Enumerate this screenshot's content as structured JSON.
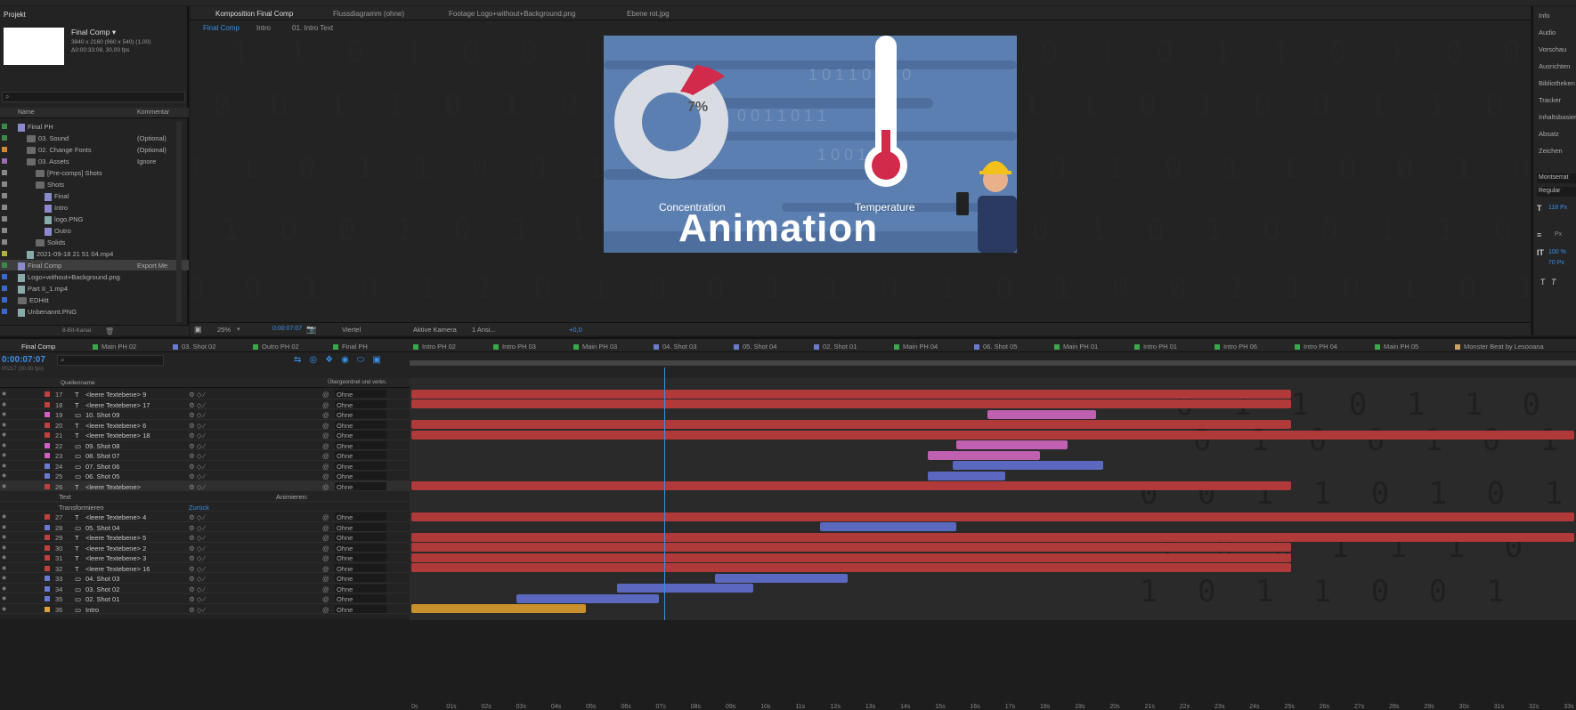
{
  "project_panel": {
    "title": "Projekt",
    "comp_name": "Final Comp ▾",
    "comp_info1": "3840 x 2160 (960 x 540) (1,00)",
    "comp_info2": "Δ0:00:33:08, 30,00 fps",
    "col_name": "Name",
    "col_comment": "Kommentar",
    "footer_depth": "8-Bit-Kanal",
    "items": [
      {
        "name": "Final PH",
        "comment": "",
        "type": "comp",
        "color": "#3a8a4a"
      },
      {
        "name": "03. Sound",
        "comment": "(Optional)",
        "type": "folder",
        "color": "#3a8a4a"
      },
      {
        "name": "02. Change Fonts",
        "comment": "(Optional)",
        "type": "folder",
        "color": "#d08a30"
      },
      {
        "name": "03. Assets",
        "comment": "Ignore",
        "type": "folder",
        "color": "#9a6bb0"
      },
      {
        "name": "[Pre-comps] Shots",
        "comment": "",
        "type": "folder",
        "color": "#888"
      },
      {
        "name": "Shots",
        "comment": "",
        "type": "folder",
        "color": "#888"
      },
      {
        "name": "Final",
        "comment": "",
        "type": "comp",
        "color": "#888"
      },
      {
        "name": "Intro",
        "comment": "",
        "type": "comp",
        "color": "#888"
      },
      {
        "name": "logo.PNG",
        "comment": "",
        "type": "file",
        "color": "#888"
      },
      {
        "name": "Outro",
        "comment": "",
        "type": "comp",
        "color": "#888"
      },
      {
        "name": "Solids",
        "comment": "",
        "type": "folder",
        "color": "#888"
      },
      {
        "name": "2021-09-18 21 51 04.mp4",
        "comment": "",
        "type": "file",
        "color": "#b0b040"
      },
      {
        "name": "Final Comp",
        "comment": "Export Me",
        "type": "comp",
        "color": "#3a8a4a"
      },
      {
        "name": "Logo+without+Background.png",
        "comment": "",
        "type": "file",
        "color": "#3a6ad0"
      },
      {
        "name": "Part II_1.mp4",
        "comment": "",
        "type": "file",
        "color": "#3a6ad0"
      },
      {
        "name": "EDHitt",
        "comment": "",
        "type": "folder",
        "color": "#3a6ad0"
      },
      {
        "name": "Unbenannt.PNG",
        "comment": "",
        "type": "file",
        "color": "#3a6ad0"
      }
    ]
  },
  "comp_panel": {
    "tabs": [
      {
        "label": "Komposition Final Comp"
      },
      {
        "label": "Flussdiagramm (ohne)"
      },
      {
        "label": "Footage Logo+without+Background.png"
      },
      {
        "label": "Ebene rot.jpg"
      }
    ],
    "breadcrumbs": [
      "Final Comp",
      "Intro",
      "01. Intro Text"
    ],
    "zoom": "25%",
    "timecode": "0:00:07:07",
    "resolution": "Viertel",
    "camera": "Aktive Kamera",
    "views": "1 Ansi...",
    "exposure": "+0,0"
  },
  "preview": {
    "donut_value": 7,
    "donut_label": "7%",
    "label_left": "Concentration",
    "label_right": "Temperature",
    "title": "Animation",
    "thermometer_level": 0.28,
    "colors": {
      "bg": "#5b7fb0",
      "accent": "#d12a4a",
      "donut": "#d9dde3"
    }
  },
  "right_panel": {
    "items": [
      "Info",
      "Audio",
      "Vorschau",
      "Ausrichten",
      "Bibliotheken",
      "Tracker",
      "Inhaltsbasiert",
      "Absatz",
      "Zeichen"
    ],
    "font": "Montserrat",
    "style": "Regular",
    "size": "118 Px",
    "tracking": "100 %",
    "leading": "70 Px",
    "units_px": "Px"
  },
  "timeline": {
    "active_tab": "Final Comp",
    "comp_tabs": [
      {
        "label": "Main PH 02",
        "color": "#3aa84a"
      },
      {
        "label": "03. Shot 02",
        "color": "#6a7ad0"
      },
      {
        "label": "Outro PH 02",
        "color": "#3aa84a"
      },
      {
        "label": "Final PH",
        "color": "#3aa84a"
      },
      {
        "label": "Intro PH 02",
        "color": "#3aa84a"
      },
      {
        "label": "Intro PH 03",
        "color": "#3aa84a"
      },
      {
        "label": "Main PH 03",
        "color": "#3aa84a"
      },
      {
        "label": "04. Shot 03",
        "color": "#6a7ad0"
      },
      {
        "label": "05. Shot 04",
        "color": "#6a7ad0"
      },
      {
        "label": "02. Shot 01",
        "color": "#6a7ad0"
      },
      {
        "label": "Main PH 04",
        "color": "#3aa84a"
      },
      {
        "label": "06. Shot 05",
        "color": "#6a7ad0"
      },
      {
        "label": "Main PH 01",
        "color": "#3aa84a"
      },
      {
        "label": "Intro PH 01",
        "color": "#3aa84a"
      },
      {
        "label": "Intro PH 06",
        "color": "#3aa84a"
      },
      {
        "label": "Intro PH 04",
        "color": "#3aa84a"
      },
      {
        "label": "Main PH 05",
        "color": "#3aa84a"
      },
      {
        "label": "Monster Beat by Lesooana",
        "color": "#c8a060"
      }
    ],
    "timecode": "0:00:07:07",
    "frame_sub": "00217 (30.00 fps)",
    "col_source": "Quellenname",
    "col_parent": "Übergeordnet und verkn.",
    "ruler": [
      "0s",
      "01s",
      "02s",
      "03s",
      "04s",
      "05s",
      "06s",
      "07s",
      "08s",
      "09s",
      "10s",
      "11s",
      "12s",
      "13s",
      "14s",
      "15s",
      "16s",
      "17s",
      "18s",
      "19s",
      "20s",
      "21s",
      "22s",
      "23s",
      "24s",
      "25s",
      "26s",
      "27s",
      "28s",
      "29s",
      "30s",
      "31s",
      "32s",
      "33s"
    ],
    "current_time_s": 7.23,
    "total_s": 33.3,
    "parent_value": "Ohne",
    "layers": [
      {
        "num": "17",
        "name": "<leere Textebene> 9",
        "type": "T",
        "color": "#c04040",
        "bar": [
          0,
          25.2
        ],
        "bcolor": "#b03a3a"
      },
      {
        "num": "18",
        "name": "<leere Textebene> 17",
        "type": "T",
        "color": "#c04040",
        "bar": [
          0,
          25.2
        ],
        "bcolor": "#b03a3a"
      },
      {
        "num": "19",
        "name": "10. Shot 09",
        "type": "C",
        "color": "#d060c0",
        "bar": [
          16.5,
          19.6
        ],
        "bcolor": "#c060b0"
      },
      {
        "num": "20",
        "name": "<leere Textebene> 6",
        "type": "T",
        "color": "#c04040",
        "bar": [
          0,
          25.2
        ],
        "bcolor": "#b03a3a"
      },
      {
        "num": "21",
        "name": "<leere Textebene> 18",
        "type": "T",
        "color": "#c04040",
        "bar": [
          0,
          33.3
        ],
        "bcolor": "#b03a3a"
      },
      {
        "num": "22",
        "name": "09. Shot 08",
        "type": "C",
        "color": "#d060c0",
        "bar": [
          15.6,
          18.8
        ],
        "bcolor": "#c060b0"
      },
      {
        "num": "23",
        "name": "08. Shot 07",
        "type": "C",
        "color": "#d060c0",
        "bar": [
          14.8,
          18.0
        ],
        "bcolor": "#c060b0"
      },
      {
        "num": "24",
        "name": "07. Shot 06",
        "type": "C",
        "color": "#6a7ad0",
        "bar": [
          15.5,
          19.8
        ],
        "bcolor": "#5a68c0"
      },
      {
        "num": "25",
        "name": "06. Shot 05",
        "type": "C",
        "color": "#6a7ad0",
        "bar": [
          14.8,
          17.0
        ],
        "bcolor": "#5a68c0"
      },
      {
        "num": "26",
        "name": "<leere Textebene>",
        "type": "T",
        "color": "#c04040",
        "bar": [
          0,
          25.2
        ],
        "bcolor": "#b03a3a",
        "expanded": true
      },
      {
        "num": "",
        "name": "Text",
        "type": "P",
        "color": "",
        "bar": null,
        "extra": "Animieren:"
      },
      {
        "num": "",
        "name": "Transformieren",
        "type": "P",
        "color": "",
        "bar": null,
        "extra": "Zurück"
      },
      {
        "num": "27",
        "name": "<leere Textebene> 4",
        "type": "T",
        "color": "#c04040",
        "bar": [
          0,
          33.3
        ],
        "bcolor": "#b03a3a"
      },
      {
        "num": "28",
        "name": "05. Shot 04",
        "type": "C",
        "color": "#6a7ad0",
        "bar": [
          11.7,
          15.6
        ],
        "bcolor": "#5a68c0"
      },
      {
        "num": "29",
        "name": "<leere Textebene> 5",
        "type": "T",
        "color": "#c04040",
        "bar": [
          0,
          33.3
        ],
        "bcolor": "#b03a3a"
      },
      {
        "num": "30",
        "name": "<leere Textebene> 2",
        "type": "T",
        "color": "#c04040",
        "bar": [
          0,
          25.2
        ],
        "bcolor": "#b03a3a"
      },
      {
        "num": "31",
        "name": "<leere Textebene> 3",
        "type": "T",
        "color": "#c04040",
        "bar": [
          0,
          25.2
        ],
        "bcolor": "#b03a3a"
      },
      {
        "num": "32",
        "name": "<leere Textebene> 16",
        "type": "T",
        "color": "#c04040",
        "bar": [
          0,
          25.2
        ],
        "bcolor": "#b03a3a"
      },
      {
        "num": "33",
        "name": "04. Shot 03",
        "type": "C",
        "color": "#6a7ad0",
        "bar": [
          8.7,
          12.5
        ],
        "bcolor": "#5a68c0"
      },
      {
        "num": "34",
        "name": "03. Shot 02",
        "type": "C",
        "color": "#6a7ad0",
        "bar": [
          5.9,
          9.8
        ],
        "bcolor": "#5a68c0"
      },
      {
        "num": "35",
        "name": "02. Shot 01",
        "type": "C",
        "color": "#6a7ad0",
        "bar": [
          3.0,
          7.1
        ],
        "bcolor": "#5a68c0"
      },
      {
        "num": "36",
        "name": "Intro",
        "type": "C",
        "color": "#e0a040",
        "bar": [
          0,
          5.0
        ],
        "bcolor": "#c8902a"
      }
    ]
  }
}
